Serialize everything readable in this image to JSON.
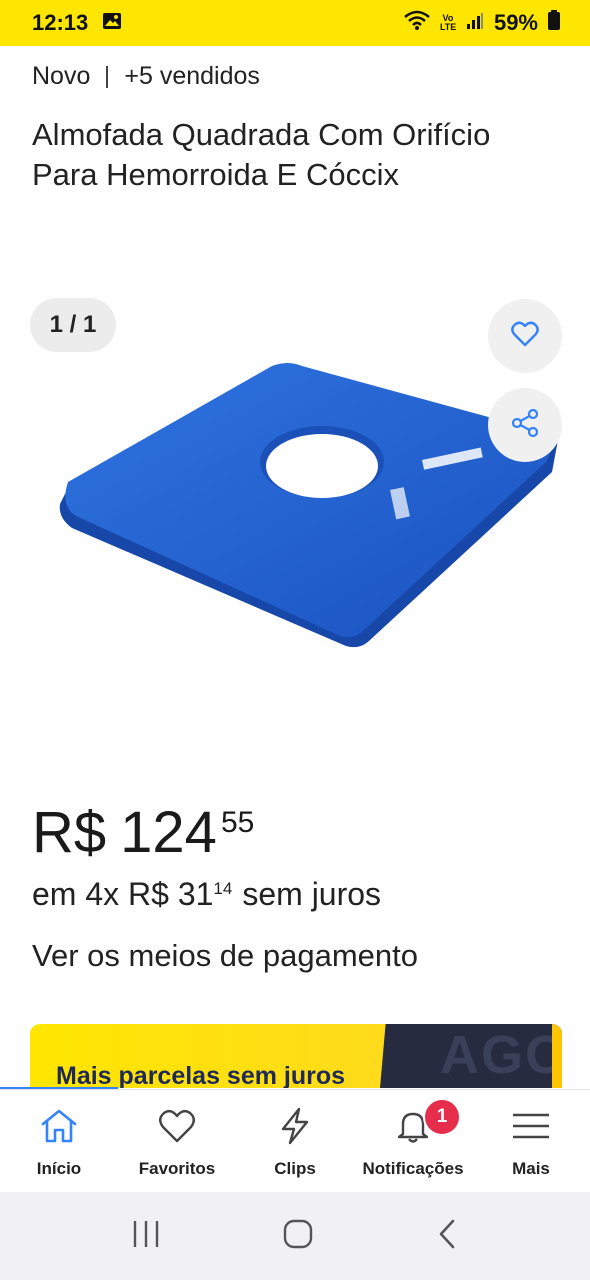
{
  "status_bar": {
    "time": "12:13",
    "image_icon": "image-icon",
    "wifi_icon": "wifi-icon",
    "volte_text": "Vo LTE",
    "signal_icon": "signal-icon",
    "battery": "59%",
    "battery_icon": "battery-icon"
  },
  "product": {
    "condition": "Novo",
    "sold": "+5 vendidos",
    "title": "Almofada Quadrada Com Orifício Para Hemorroida E Cóccix",
    "image_counter": "1 / 1",
    "favorite_icon": "heart-outline-icon",
    "share_icon": "share-icon",
    "image_color": "#1e5fcf"
  },
  "price": {
    "currency": "R$",
    "integer": "124",
    "cents": "55",
    "installments_prefix": "em 4x R$ 31",
    "installments_cents": "14",
    "installments_suffix": "sem juros",
    "payment_link": "Ver os meios de pagamento"
  },
  "banner": {
    "text": "Mais parcelas sem juros",
    "ghost_text": "AGO",
    "accent": "#ffe600"
  },
  "bottom_nav": {
    "items": [
      {
        "label": "Início",
        "icon": "home-icon"
      },
      {
        "label": "Favoritos",
        "icon": "heart-icon"
      },
      {
        "label": "Clips",
        "icon": "bolt-icon"
      },
      {
        "label": "Notificações",
        "icon": "bell-icon",
        "badge": "1"
      },
      {
        "label": "Mais",
        "icon": "menu-icon"
      }
    ],
    "active_color": "#3483fa",
    "badge_color": "#e62e4c"
  },
  "system_nav": {
    "recents_icon": "recents-icon",
    "home_icon": "home-circle-icon",
    "back_icon": "back-icon"
  }
}
